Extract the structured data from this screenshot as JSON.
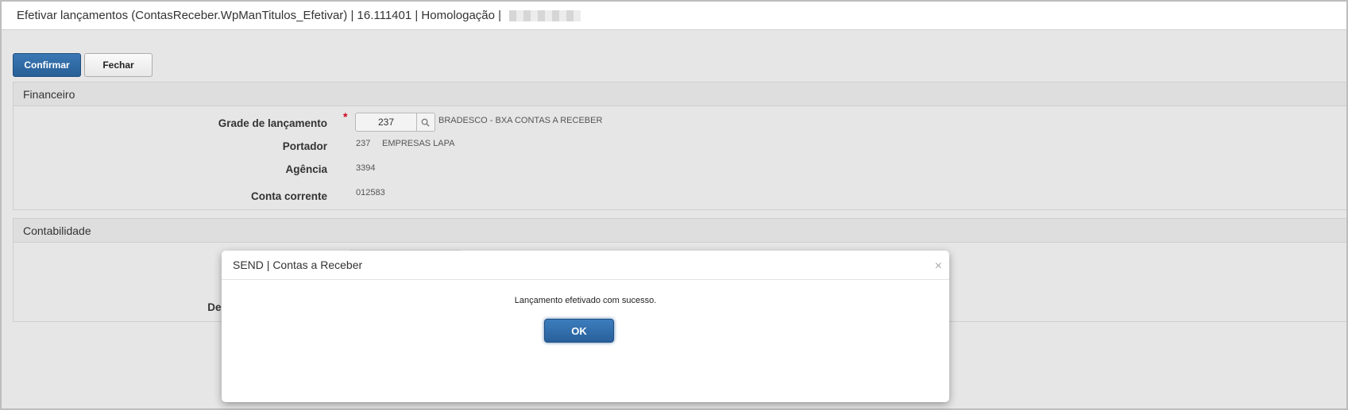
{
  "window": {
    "title": "Efetivar lançamentos (ContasReceber.WpManTitulos_Efetivar) | 16.111401 | Homologação |"
  },
  "toolbar": {
    "confirm_label": "Confirmar",
    "close_label": "Fechar"
  },
  "financeiro": {
    "title": "Financeiro",
    "grade_label": "Grade de lançamento",
    "grade_value": "237",
    "grade_desc": "BRADESCO - BXA CONTAS A RECEBER",
    "portador_label": "Portador",
    "portador_code": "237",
    "portador_name": "EMPRESAS LAPA",
    "agencia_label": "Agência",
    "agencia_value": "3394",
    "conta_label": "Conta corrente",
    "conta_value": "012583"
  },
  "contabilidade": {
    "title": "Contabilidade",
    "partial_label": "Des"
  },
  "modal": {
    "title": "SEND | Contas a Receber",
    "close_glyph": "×",
    "message": "Lançamento efetivado com sucesso.",
    "ok_label": "OK"
  },
  "icons": {
    "search": "search-icon",
    "close": "close-icon",
    "required": "required-asterisk"
  },
  "colors": {
    "primary": "#2d6aa8",
    "required": "#d0021b",
    "background": "#e6e6e6"
  }
}
